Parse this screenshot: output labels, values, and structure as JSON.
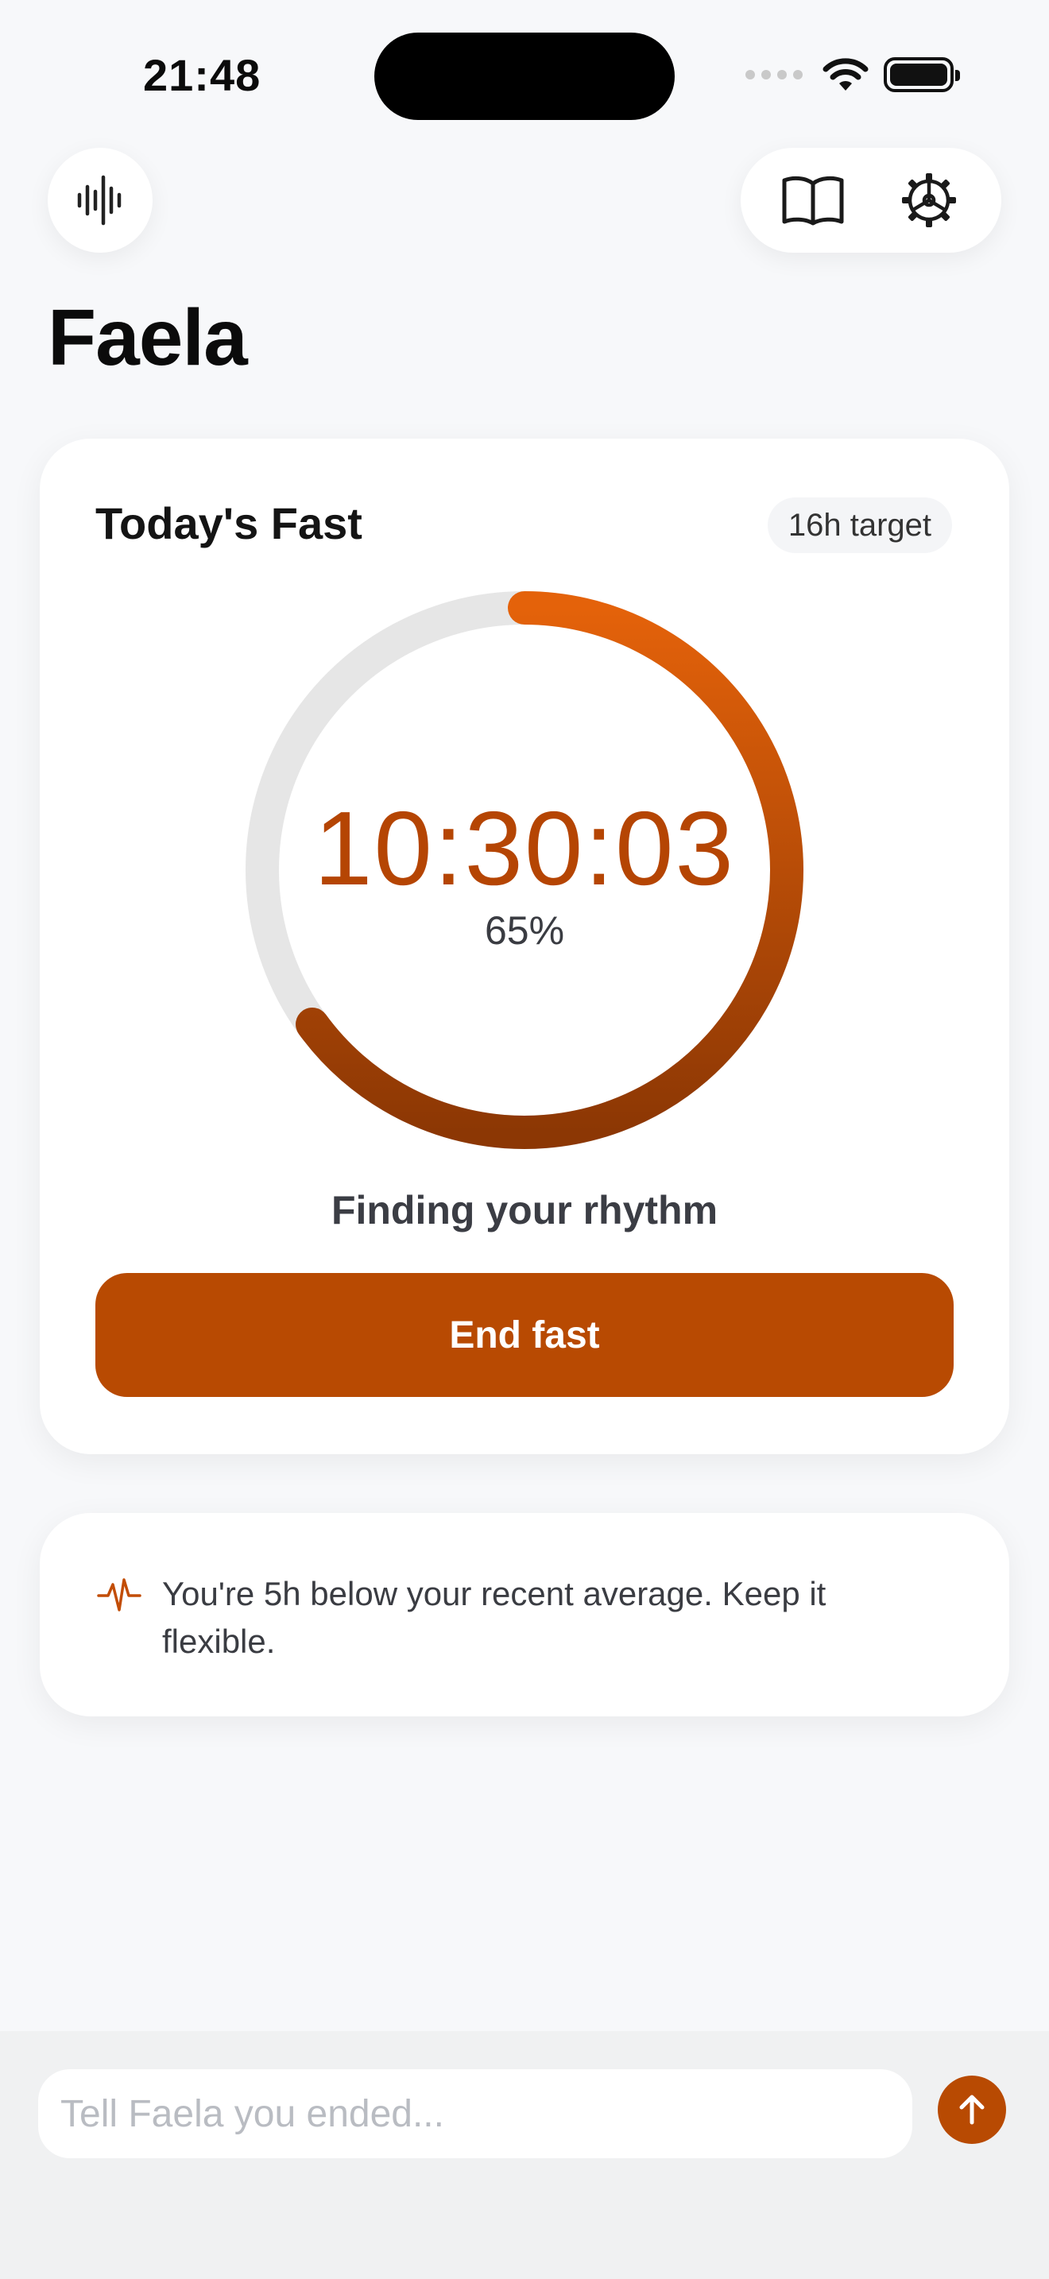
{
  "status_bar": {
    "time": "21:48",
    "icons": [
      "signal-icon",
      "wifi-icon",
      "battery-icon"
    ]
  },
  "header": {
    "title": "Faela",
    "left_button_icon": "voice-waveform-icon",
    "right_buttons": [
      "book-icon",
      "settings-gear-icon"
    ]
  },
  "fast_card": {
    "title": "Today's Fast",
    "target_label": "16h target",
    "elapsed": "10:30:03",
    "progress_percent_label": "65%",
    "progress": 0.65,
    "phase_label": "Finding your rhythm",
    "end_button_label": "End fast"
  },
  "insight": {
    "icon": "heartbeat-icon",
    "text": "You're 5h below your recent average. Keep it flexible."
  },
  "composer": {
    "placeholder": "Tell Faela you ended...",
    "value": "",
    "send_icon": "arrow-up-icon"
  },
  "colors": {
    "accent": "#b84a02",
    "gradient_start": "#e4620a",
    "gradient_end": "#8c3704",
    "track": "#e6e6e6"
  }
}
